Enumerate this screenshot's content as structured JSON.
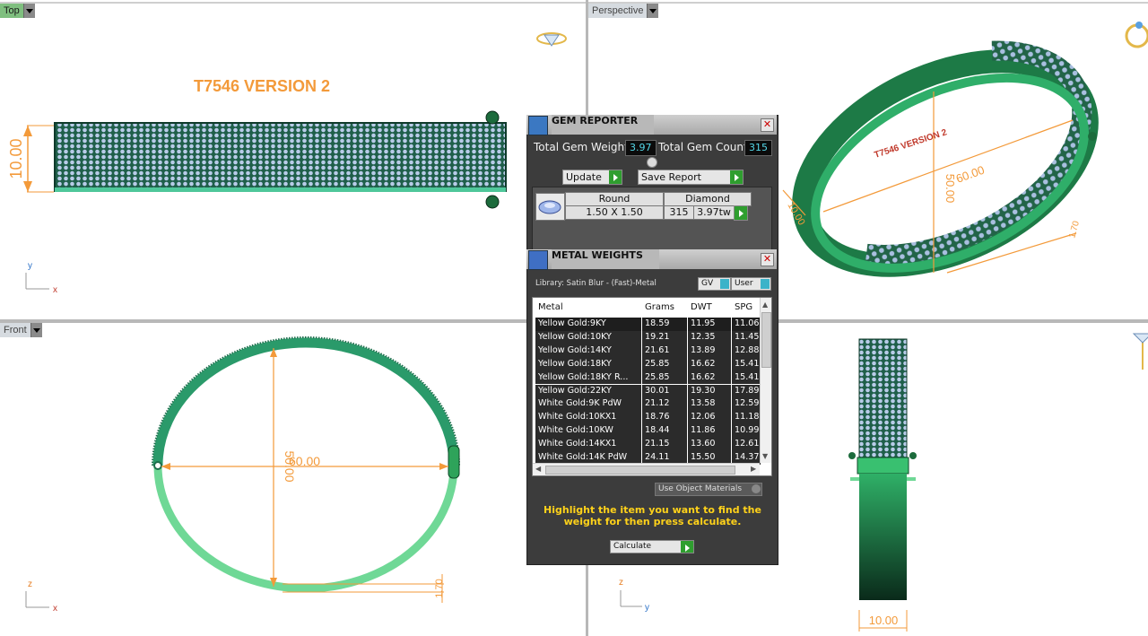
{
  "viewports": {
    "top": {
      "label": "Top",
      "title_text": "T7546 VERSION 2",
      "dim_height": "10.00",
      "axis_y": "y",
      "axis_x": "x"
    },
    "perspective": {
      "label": "Perspective",
      "dim_diameter": "60.00",
      "dim_depth": "50.00",
      "dim_width": "10.00",
      "dim_thickness": "1.70",
      "engraving": "T7546 VERSION 2"
    },
    "front": {
      "label": "Front",
      "dim_diameter": "60.00",
      "dim_depth": "50.00",
      "dim_thickness": "1.70",
      "axis_z": "z",
      "axis_x": "x"
    },
    "right": {
      "dim_width": "10.00",
      "axis_z": "z",
      "axis_y": "y"
    }
  },
  "gem_reporter": {
    "title": "GEM REPORTER",
    "total_weight_label": "Total Gem Weight",
    "total_weight_value": "3.97",
    "total_count_label": "Total Gem Count",
    "total_count_value": "315",
    "update_label": "Update",
    "save_report_label": "Save Report",
    "gem": {
      "shape": "Round",
      "size": "1.50 X 1.50",
      "material": "Diamond",
      "count": "315",
      "weight": "3.97tw"
    }
  },
  "metal_weights": {
    "title": "METAL WEIGHTS",
    "library": "Library: Satin Blur - (Fast)-Metal",
    "gv_label": "GV",
    "user_label": "User",
    "columns": [
      "Metal",
      "Grams",
      "DWT",
      "SPG"
    ],
    "rows": [
      [
        "Yellow Gold:9KY",
        "18.59",
        "11.95",
        "11.06"
      ],
      [
        "Yellow Gold:10KY",
        "19.21",
        "12.35",
        "11.45"
      ],
      [
        "Yellow Gold:14KY",
        "21.61",
        "13.89",
        "12.88"
      ],
      [
        "Yellow Gold:18KY",
        "25.85",
        "16.62",
        "15.41"
      ],
      [
        "Yellow Gold:18KY R...",
        "25.85",
        "16.62",
        "15.41"
      ],
      [
        "Yellow Gold:22KY",
        "30.01",
        "19.30",
        "17.89"
      ],
      [
        "White Gold:9K PdW",
        "21.12",
        "13.58",
        "12.59"
      ],
      [
        "White Gold:10KX1",
        "18.76",
        "12.06",
        "11.18"
      ],
      [
        "White Gold:10KW",
        "18.44",
        "11.86",
        "10.99"
      ],
      [
        "White Gold:14KX1",
        "21.15",
        "13.60",
        "12.61"
      ],
      [
        "White Gold:14K PdW",
        "24.11",
        "15.50",
        "14.37"
      ]
    ],
    "use_object_materials": "Use Object Materials",
    "message": "Highlight the item you want to find the weight for then press calculate.",
    "calculate_label": "Calculate"
  },
  "colors": {
    "accent_orange": "#f39a3a",
    "panel_dark": "#3c3c3c",
    "value_cyan": "#55d7e8",
    "message_yellow": "#ffd21a",
    "band_green": "#2f9a6a"
  }
}
